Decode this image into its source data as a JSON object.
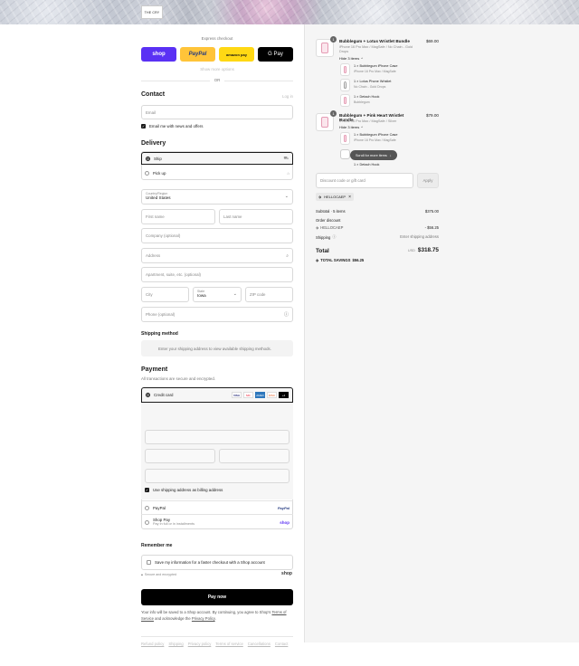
{
  "header": {
    "logo_text": "THE CRY"
  },
  "express": {
    "title": "Express checkout",
    "shop_label": "shop",
    "paypal_label": "PayPal",
    "amazon_label": "amazon pay",
    "gpay_label": "G Pay",
    "show_more": "Show more options",
    "or": "OR"
  },
  "contact": {
    "title": "Contact",
    "login": "Log in",
    "email_placeholder": "Email",
    "news_label": "Email me with news and offers"
  },
  "delivery": {
    "title": "Delivery",
    "ship": "Ship",
    "pickup": "Pick up",
    "country_label": "Country/Region",
    "country_value": "United States",
    "first_name": "First name",
    "last_name": "Last name",
    "company": "Company (optional)",
    "address": "Address",
    "apartment": "Apartment, suite, etc. (optional)",
    "city": "City",
    "state_label": "State",
    "state_value": "Iowa",
    "zip": "ZIP code",
    "phone": "Phone (optional)"
  },
  "shipping_method": {
    "title": "Shipping method",
    "note": "Enter your shipping address to view available shipping methods."
  },
  "payment": {
    "title": "Payment",
    "subtitle": "All transactions are secure and encrypted.",
    "credit_card": "Credit card",
    "card_brands": [
      "VISA",
      "MC",
      "AMEX",
      "DISC",
      "+4"
    ],
    "billing_same": "Use shipping address as billing address",
    "paypal": "PayPal",
    "paypal_logo": "PayPal",
    "shoppay": "Shop Pay",
    "shoppay_sub": "Pay in full or in installments",
    "shoppay_logo": "shop"
  },
  "remember": {
    "title": "Remember me",
    "save_label": "Save my information for a faster checkout with a Shop account",
    "secure": "Secure and encrypted",
    "shop_logo": "shop"
  },
  "pay_now": "Pay now",
  "legal": {
    "text": "Your info will be saved to a Shop account. By continuing, you agree to Shop's",
    "terms": "Terms of Service",
    "and": "and acknowledge the",
    "privacy": "Privacy Policy"
  },
  "footer_links": [
    "Refund policy",
    "Shipping",
    "Privacy policy",
    "Terms of service",
    "Cancellations",
    "Contact"
  ],
  "summary": {
    "items": [
      {
        "qty": "1",
        "title": "Bubblegum + Lotus Wristlet Bundle",
        "variant": "iPhone 16 Pro Max / MagSafe / No Chain - Gold Drops",
        "price": "$69.00",
        "hide": "Hide 3 items",
        "subs": [
          {
            "title": "1 × Bubblegum iPhone Case",
            "variant": "iPhone 16 Pro Max / MagSafe"
          },
          {
            "title": "1 × Lotus Phone Wristlet",
            "variant": "No Chain - Gold Drops"
          },
          {
            "title": "1 × Detach Hook",
            "variant": "Bubblegum"
          }
        ]
      },
      {
        "qty": "1",
        "title": "Bubblegum + Pink Heart Wristlet Bundle",
        "variant": "iPhone 16 Pro Max / MagSafe / Silver",
        "price": "$79.00",
        "hide": "Hide 3 items",
        "subs": [
          {
            "title": "1 × Bubblegum iPhone Case",
            "variant": "iPhone 16 Pro Max / MagSafe"
          },
          {
            "title": "1 × Detach Hook",
            "variant": ""
          }
        ]
      }
    ],
    "scroll_hint": "Scroll for more items",
    "discount_placeholder": "Discount code or gift card",
    "apply": "Apply",
    "code_tag": "HELLOCAEP",
    "subtotal_label": "Subtotal · 5 items",
    "subtotal_value": "$375.00",
    "order_discount": "Order discount",
    "discount_code": "HELLOCAEP",
    "discount_value": "- $56.25",
    "shipping_label": "Shipping",
    "shipping_value": "Enter shipping address",
    "total_label": "Total",
    "currency": "USD",
    "total_value": "$318.75",
    "savings_label": "TOTAL SAVINGS",
    "savings_value": "$56.25"
  },
  "colors": {
    "shop": "#5a31f4",
    "paypal": "#ffc439",
    "amazon": "#ffd814",
    "gpay": "#000000",
    "pay_now": "#000000"
  }
}
